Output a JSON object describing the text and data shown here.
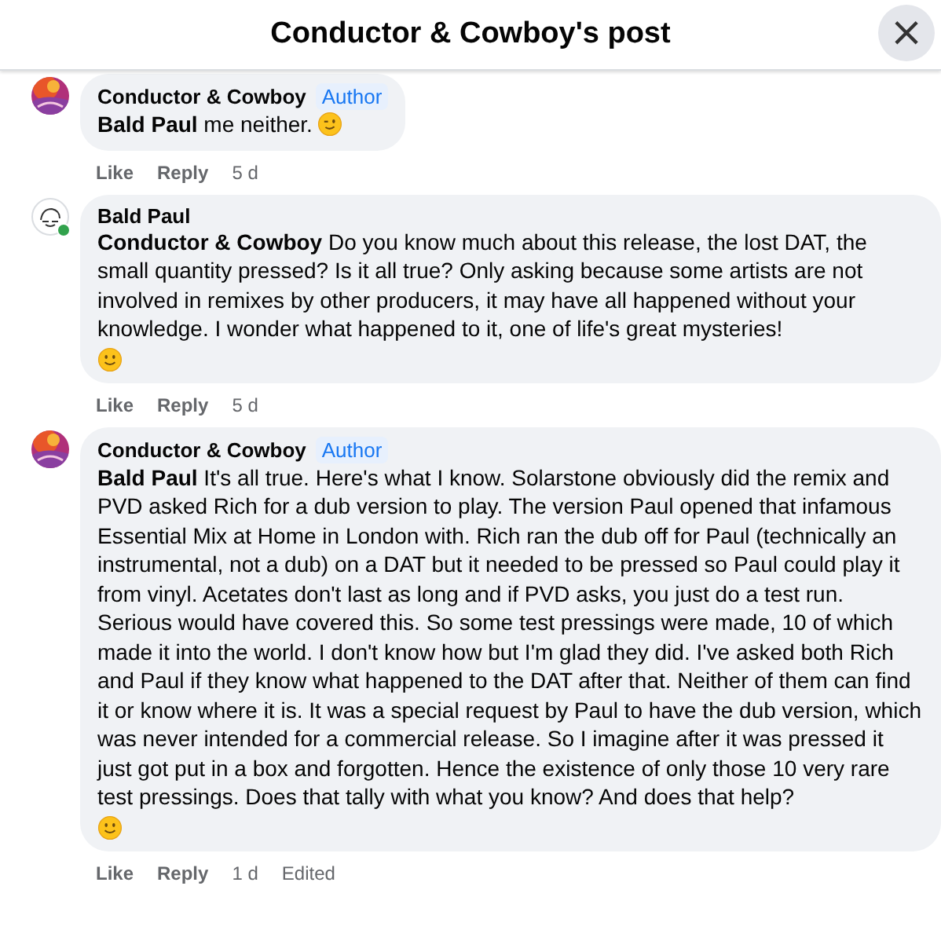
{
  "header": {
    "title": "Conductor & Cowboy's post",
    "close": "×"
  },
  "comments": [
    {
      "avatar": {
        "kind": "picture"
      },
      "online": false,
      "author": "Conductor & Cowboy",
      "badge": "Author",
      "text": "**Bald Paul** me neither.",
      "emoji": {
        "kind": "wink"
      },
      "actions": [
        "Like",
        "Reply"
      ],
      "time": "5 d"
    },
    {
      "avatar": {
        "kind": "drawing"
      },
      "online": true,
      "author": "Bald Paul",
      "text": "**Conductor & Cowboy** Do you know much about this release, the lost DAT, the small quantity pressed? Is it all true? Only asking because some artists are not involved in remixes by other producers, it may have all happened without your knowledge. I wonder what happened to it, one of life's great mysteries!",
      "emoji": {
        "kind": "smile",
        "own_line": true
      },
      "actions": [
        "Like",
        "Reply"
      ],
      "time": "5 d"
    },
    {
      "avatar": {
        "kind": "picture"
      },
      "online": false,
      "author": "Conductor & Cowboy",
      "badge": "Author",
      "text": "**Bald Paul** It's all true. Here's what I know. Solarstone obviously did the remix and PVD asked Rich for a dub version to play. The version Paul opened that infamous Essential Mix at Home in London with. Rich ran the dub off for Paul (technically an instrumental, not a dub) on a DAT but it needed to be pressed so Paul could play it from vinyl. Acetates don't last as long and if PVD asks, you just do a test run. Serious would have covered this. So some test pressings were made, 10 of which made it into the world. I don't know how but I'm glad they did. I've asked both Rich and Paul if they know what happened to the DAT after that. Neither of them can find it or know where it is. It was a special request by Paul to have the dub version, which was never intended for a commercial release. So I imagine after it was pressed it just got put in a box and forgotten. Hence the existence of only those 10 very rare test pressings. Does that tally with what you know? And does that help?",
      "emoji": {
        "kind": "smile",
        "own_line": true
      },
      "actions": [
        "Like",
        "Reply"
      ],
      "time": "1 d",
      "edited": "Edited"
    }
  ]
}
